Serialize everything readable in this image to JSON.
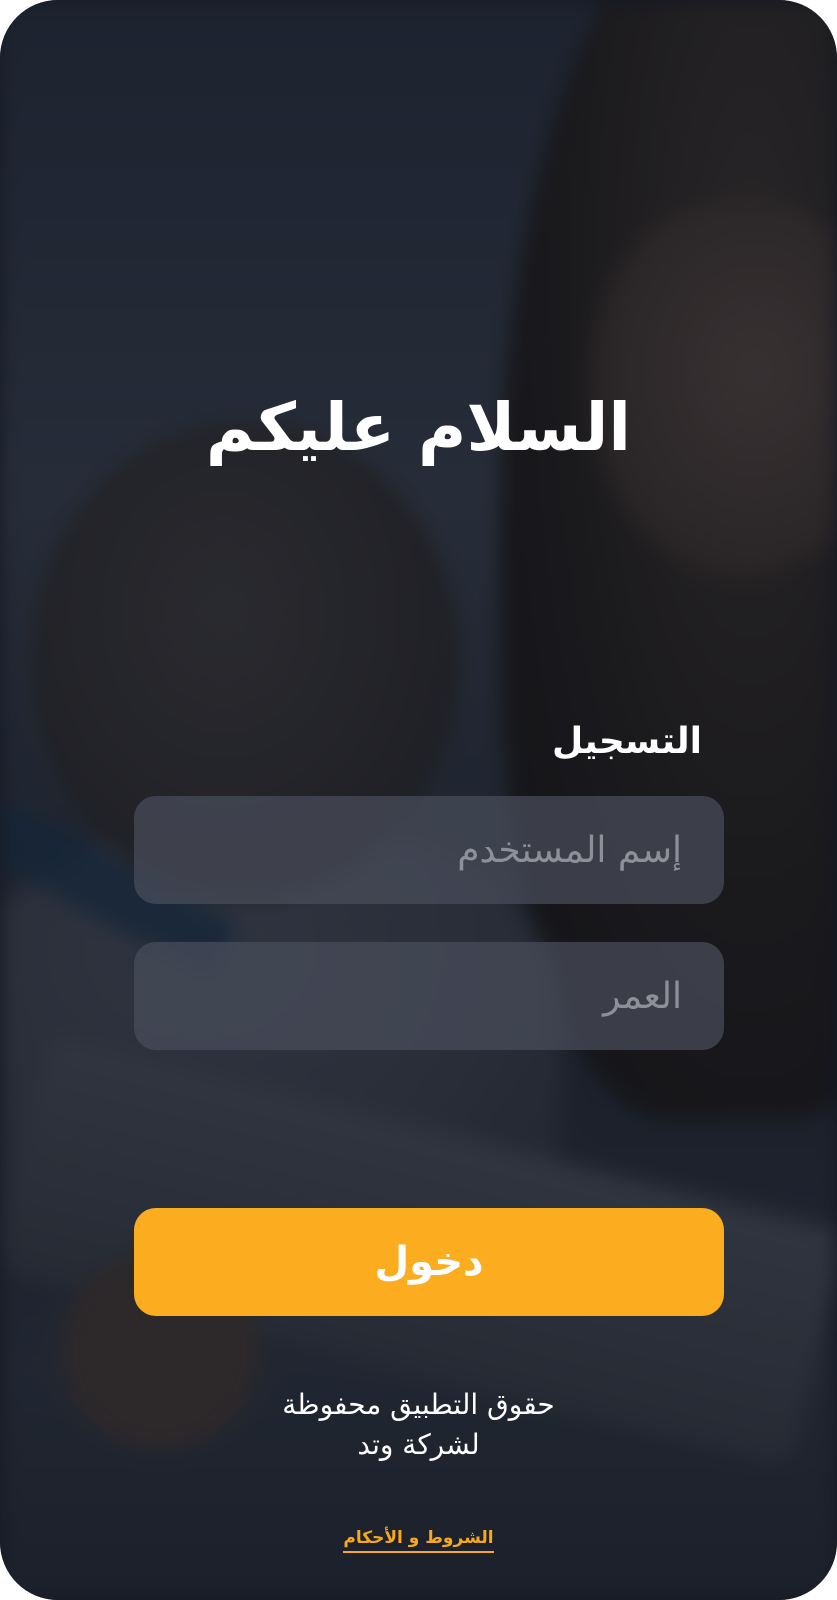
{
  "greeting": "السلام عليكم",
  "section_label": "التسجيل",
  "username_field": {
    "value": "",
    "placeholder": "إسم المستخدم"
  },
  "age_field": {
    "value": "",
    "placeholder": "العمر"
  },
  "login_button": "دخول",
  "copyright": {
    "line1": "حقوق التطبيق محفوظة",
    "line2": "لشركة وتد"
  },
  "terms_link": "الشروط و الأحكام",
  "colors": {
    "accent": "#fbac1f",
    "text": "#ffffff",
    "field_bg": "#4a4e5c"
  }
}
